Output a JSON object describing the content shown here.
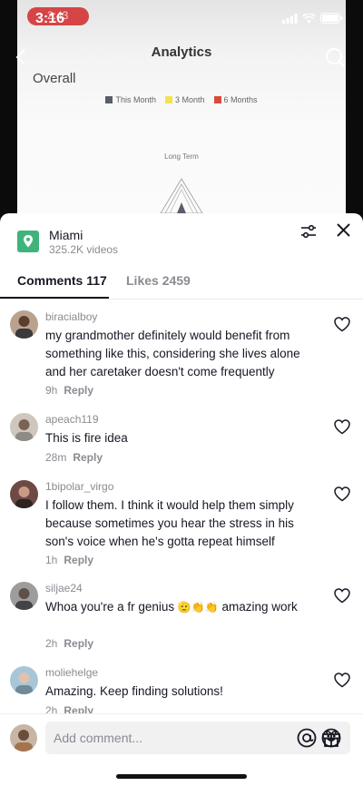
{
  "status_bar": {
    "time": "3:16",
    "recording_time": "2:43"
  },
  "video": {
    "title": "Analytics",
    "section": "Overall",
    "legend": [
      {
        "label": "This Month",
        "color": "#5a5e6b"
      },
      {
        "label": "3 Month",
        "color": "#f3e24c"
      },
      {
        "label": "6 Months",
        "color": "#d94b3b"
      }
    ],
    "axis_label": "Long Term"
  },
  "location": {
    "name": "Miami",
    "videos": "325.2K videos",
    "icon_color": "#3fb47a"
  },
  "tabs": {
    "comments": "Comments 117",
    "likes": "Likes 2459"
  },
  "comments": [
    {
      "user": "biracialboy",
      "text": "my grandmother definitely would benefit from something like this, considering she lives alone and her caretaker doesn't come frequently",
      "time": "9h",
      "reply": "Reply"
    },
    {
      "user": "apeach119",
      "text": "This is fire idea",
      "time": "28m",
      "reply": "Reply"
    },
    {
      "user": "1bipolar_virgo",
      "text": "I follow them. I think it would help them simply because sometimes you hear the stress in his son's voice when he's gotta repeat himself",
      "time": "1h",
      "reply": "Reply"
    },
    {
      "user": "siljae24",
      "text": "Whoa you're a fr genius",
      "text_emoji": "🫡👏👏",
      "text_after": "amazing work",
      "time": "2h",
      "reply": "Reply"
    },
    {
      "user": "moliehelge",
      "text": "Amazing. Keep finding solutions!",
      "time": "2h",
      "reply": "Reply"
    }
  ],
  "input": {
    "placeholder": "Add comment..."
  }
}
